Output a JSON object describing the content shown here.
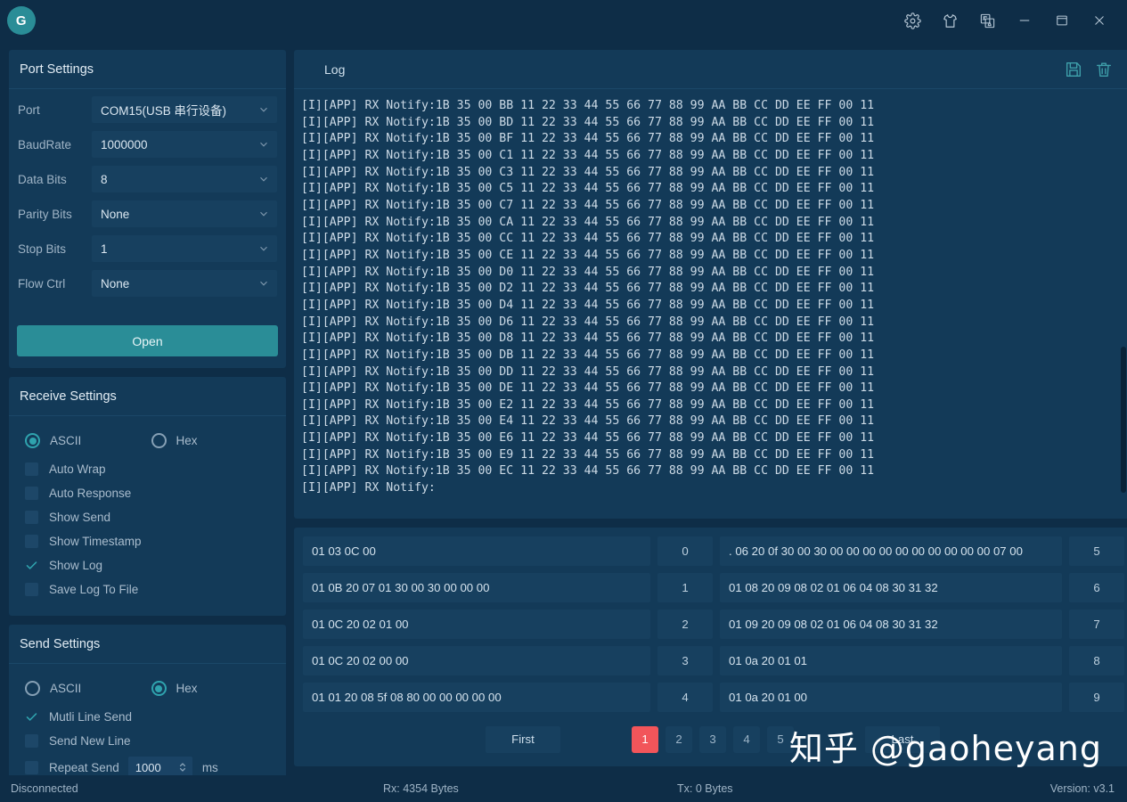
{
  "titlebar": {
    "logo_letter": "G",
    "buttons": [
      {
        "name": "settings-icon",
        "label": "Settings"
      },
      {
        "name": "theme-icon",
        "label": "Theme"
      },
      {
        "name": "language-icon",
        "label": "Language"
      },
      {
        "name": "minimize-icon",
        "label": "Minimize"
      },
      {
        "name": "maximize-icon",
        "label": "Maximize"
      },
      {
        "name": "close-icon",
        "label": "Close"
      }
    ]
  },
  "port_settings": {
    "title": "Port Settings",
    "fields": [
      {
        "label": "Port",
        "value": "COM15(USB 串行设备)"
      },
      {
        "label": "BaudRate",
        "value": "1000000"
      },
      {
        "label": "Data Bits",
        "value": "8"
      },
      {
        "label": "Parity Bits",
        "value": "None"
      },
      {
        "label": "Stop Bits",
        "value": "1"
      },
      {
        "label": "Flow Ctrl",
        "value": "None"
      }
    ],
    "open_button": "Open"
  },
  "receive_settings": {
    "title": "Receive Settings",
    "format": {
      "ascii": "ASCII",
      "hex": "Hex",
      "selected": "ASCII"
    },
    "checks": [
      {
        "label": "Auto Wrap",
        "checked": false
      },
      {
        "label": "Auto Response",
        "checked": false
      },
      {
        "label": "Show Send",
        "checked": false
      },
      {
        "label": "Show Timestamp",
        "checked": false
      },
      {
        "label": "Show Log",
        "checked": true
      },
      {
        "label": "Save Log To File",
        "checked": false
      }
    ]
  },
  "send_settings": {
    "title": "Send Settings",
    "format": {
      "ascii": "ASCII",
      "hex": "Hex",
      "selected": "Hex"
    },
    "checks": [
      {
        "label": "Mutli Line Send",
        "checked": true
      },
      {
        "label": "Send New Line",
        "checked": false
      }
    ],
    "repeat": {
      "label": "Repeat Send",
      "checked": false,
      "value": "1000",
      "unit": "ms"
    }
  },
  "log": {
    "tab_label": "Log",
    "save_icon": "save-icon",
    "clear_icon": "trash-icon",
    "lines": [
      "[I][APP] RX Notify:1B 35 00 BB 11 22 33 44 55 66 77 88 99 AA BB CC DD EE FF 00 11",
      "[I][APP] RX Notify:1B 35 00 BD 11 22 33 44 55 66 77 88 99 AA BB CC DD EE FF 00 11",
      "[I][APP] RX Notify:1B 35 00 BF 11 22 33 44 55 66 77 88 99 AA BB CC DD EE FF 00 11",
      "[I][APP] RX Notify:1B 35 00 C1 11 22 33 44 55 66 77 88 99 AA BB CC DD EE FF 00 11",
      "[I][APP] RX Notify:1B 35 00 C3 11 22 33 44 55 66 77 88 99 AA BB CC DD EE FF 00 11",
      "[I][APP] RX Notify:1B 35 00 C5 11 22 33 44 55 66 77 88 99 AA BB CC DD EE FF 00 11",
      "[I][APP] RX Notify:1B 35 00 C7 11 22 33 44 55 66 77 88 99 AA BB CC DD EE FF 00 11",
      "[I][APP] RX Notify:1B 35 00 CA 11 22 33 44 55 66 77 88 99 AA BB CC DD EE FF 00 11",
      "[I][APP] RX Notify:1B 35 00 CC 11 22 33 44 55 66 77 88 99 AA BB CC DD EE FF 00 11",
      "[I][APP] RX Notify:1B 35 00 CE 11 22 33 44 55 66 77 88 99 AA BB CC DD EE FF 00 11",
      "[I][APP] RX Notify:1B 35 00 D0 11 22 33 44 55 66 77 88 99 AA BB CC DD EE FF 00 11",
      "[I][APP] RX Notify:1B 35 00 D2 11 22 33 44 55 66 77 88 99 AA BB CC DD EE FF 00 11",
      "[I][APP] RX Notify:1B 35 00 D4 11 22 33 44 55 66 77 88 99 AA BB CC DD EE FF 00 11",
      "[I][APP] RX Notify:1B 35 00 D6 11 22 33 44 55 66 77 88 99 AA BB CC DD EE FF 00 11",
      "[I][APP] RX Notify:1B 35 00 D8 11 22 33 44 55 66 77 88 99 AA BB CC DD EE FF 00 11",
      "[I][APP] RX Notify:1B 35 00 DB 11 22 33 44 55 66 77 88 99 AA BB CC DD EE FF 00 11",
      "[I][APP] RX Notify:1B 35 00 DD 11 22 33 44 55 66 77 88 99 AA BB CC DD EE FF 00 11",
      "[I][APP] RX Notify:1B 35 00 DE 11 22 33 44 55 66 77 88 99 AA BB CC DD EE FF 00 11",
      "[I][APP] RX Notify:1B 35 00 E2 11 22 33 44 55 66 77 88 99 AA BB CC DD EE FF 00 11",
      "[I][APP] RX Notify:1B 35 00 E4 11 22 33 44 55 66 77 88 99 AA BB CC DD EE FF 00 11",
      "[I][APP] RX Notify:1B 35 00 E6 11 22 33 44 55 66 77 88 99 AA BB CC DD EE FF 00 11",
      "[I][APP] RX Notify:1B 35 00 E9 11 22 33 44 55 66 77 88 99 AA BB CC DD EE FF 00 11",
      "[I][APP] RX Notify:1B 35 00 EC 11 22 33 44 55 66 77 88 99 AA BB CC DD EE FF 00 11",
      "[I][APP] RX Notify:"
    ]
  },
  "send_table": {
    "rows_left": [
      {
        "value": "01 03 0C 00",
        "index": "0"
      },
      {
        "value": "01 0B 20 07  01 30 00 30 00 00 00",
        "index": "1"
      },
      {
        "value": "01 0C 20 02 01 00",
        "index": "2"
      },
      {
        "value": "01 0C 20 02 00 00",
        "index": "3"
      },
      {
        "value": "01 01 20 08 5f 08 80 00 00 00 00 00",
        "index": "4"
      }
    ],
    "rows_right": [
      {
        "value": ". 06 20 0f 30 00 30 00 00 00 00 00 00 00 00 00 00 07 00",
        "index": "5"
      },
      {
        "value": "01 08 20 09 08 02 01 06 04 08 30 31 32",
        "index": "6"
      },
      {
        "value": "01 09 20 09 08 02 01 06 04 08 30 31 32",
        "index": "7"
      },
      {
        "value": "01 0a 20 01 01",
        "index": "8"
      },
      {
        "value": "01 0a 20 01 00",
        "index": "9"
      }
    ],
    "pagination": {
      "first": "First",
      "last": "Last",
      "pages": [
        "1",
        "2",
        "3",
        "4",
        "5"
      ],
      "active": "1"
    }
  },
  "statusbar": {
    "connection": "Disconnected",
    "rx": "Rx: 4354 Bytes",
    "tx": "Tx: 0 Bytes",
    "version": "Version: v3.1"
  },
  "watermark": "知乎 @gaoheyang",
  "colors": {
    "background": "#0e2d47",
    "panel": "#133a58",
    "input": "#17405f",
    "accent": "#2a8d97",
    "active_page": "#f2555a"
  }
}
